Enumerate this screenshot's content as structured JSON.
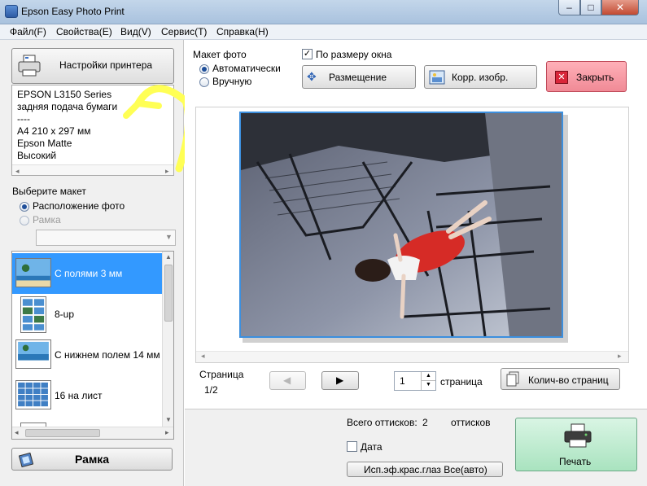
{
  "window": {
    "title": "Epson Easy Photo Print",
    "min": "–",
    "max": "□",
    "close": "✕"
  },
  "menu": [
    "Файл(F)",
    "Свойства(E)",
    "Вид(V)",
    "Сервис(T)",
    "Справка(H)"
  ],
  "printer": {
    "button_label": "Настройки принтера",
    "info": [
      "EPSON L3150 Series",
      "задняя подача бумаги",
      "----",
      "A4 210 x 297 мм",
      "Epson Matte",
      "Высокий"
    ]
  },
  "layout_select": {
    "title": "Выберите макет",
    "option_photo": "Расположение фото",
    "option_frame": "Рамка",
    "items": [
      "С полями 3 мм",
      "8-up",
      "С нижнем полем 14 мм",
      "16 на лист"
    ]
  },
  "frame_button": "Рамка",
  "photo_layout": {
    "title": "Макет фото",
    "auto": "Автоматически",
    "manual": "Вручную"
  },
  "fit_window": "По размеру окна",
  "buttons": {
    "placement": "Размещение",
    "correct": "Корр. изобр.",
    "close": "Закрыть",
    "pages_count": "Колич-во страниц",
    "print": "Печать",
    "redeye": "Исп.эф.крас.глаз Все(авто)"
  },
  "pager": {
    "label": "Страница",
    "value": "1/2",
    "spin_value": "1",
    "unit": "страница"
  },
  "totals": {
    "label": "Всего оттисков:",
    "count": "2",
    "unit": "оттисков"
  },
  "date_label": "Дата",
  "colors": {
    "accent": "#3399ff",
    "close_bg": "#f59aa4",
    "print_bg": "#b8e9cb",
    "highlight": "#ffff66"
  }
}
